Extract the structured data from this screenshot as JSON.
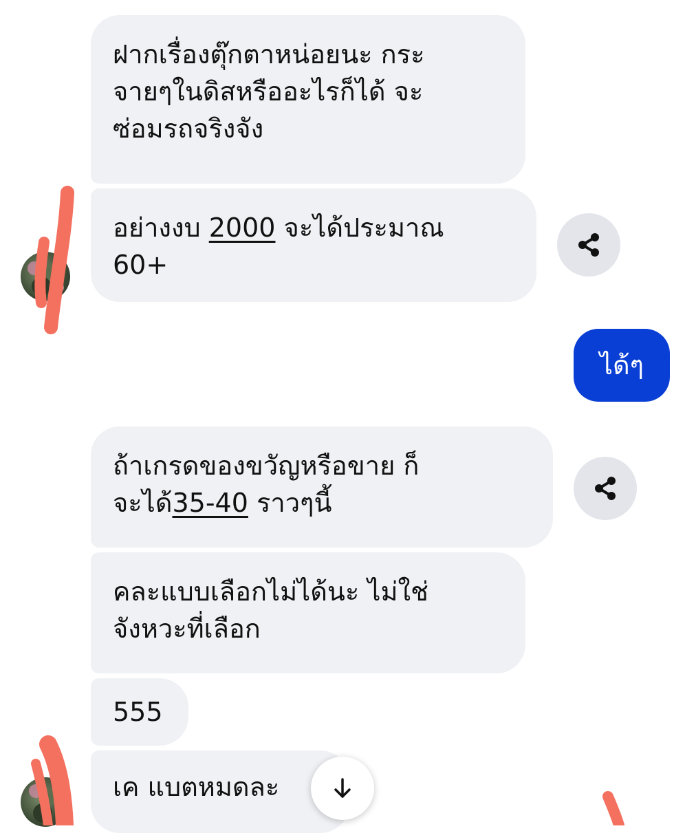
{
  "messages": {
    "m1": {
      "line1": "ฝากเรื่องตุ๊กตาหน่อยนะ กระ",
      "line2": "จายๆในดิสหรืออะไรก็ได้ จะ",
      "line3": "ซ่อมรถจริงจัง"
    },
    "m2": {
      "pre": "อย่างงบ ",
      "link": "2000",
      "post": " จะได้ประมาณ",
      "line2": "60+"
    },
    "m3_sent": {
      "text": "ได้ๆ"
    },
    "m4": {
      "line1": "ถ้าเกรดของขวัญหรือขาย ก็",
      "pre": "จะได้",
      "link": "35-40",
      "post": " ราวๆนี้"
    },
    "m5": {
      "line1": "คละแบบเลือกไม่ได้นะ ไม่ใช่",
      "line2": "จังหวะที่เลือก"
    },
    "m6": {
      "text": "555"
    },
    "m7": {
      "text": "เค แบตหมดละ"
    }
  },
  "icons": {
    "share": "share-icon",
    "scroll": "arrow-down-icon",
    "avatar": "contact-avatar"
  },
  "colors": {
    "received_bubble": "#f0f1f5",
    "sent_bubble": "#0a3fd6",
    "annotation": "#f4705f"
  }
}
